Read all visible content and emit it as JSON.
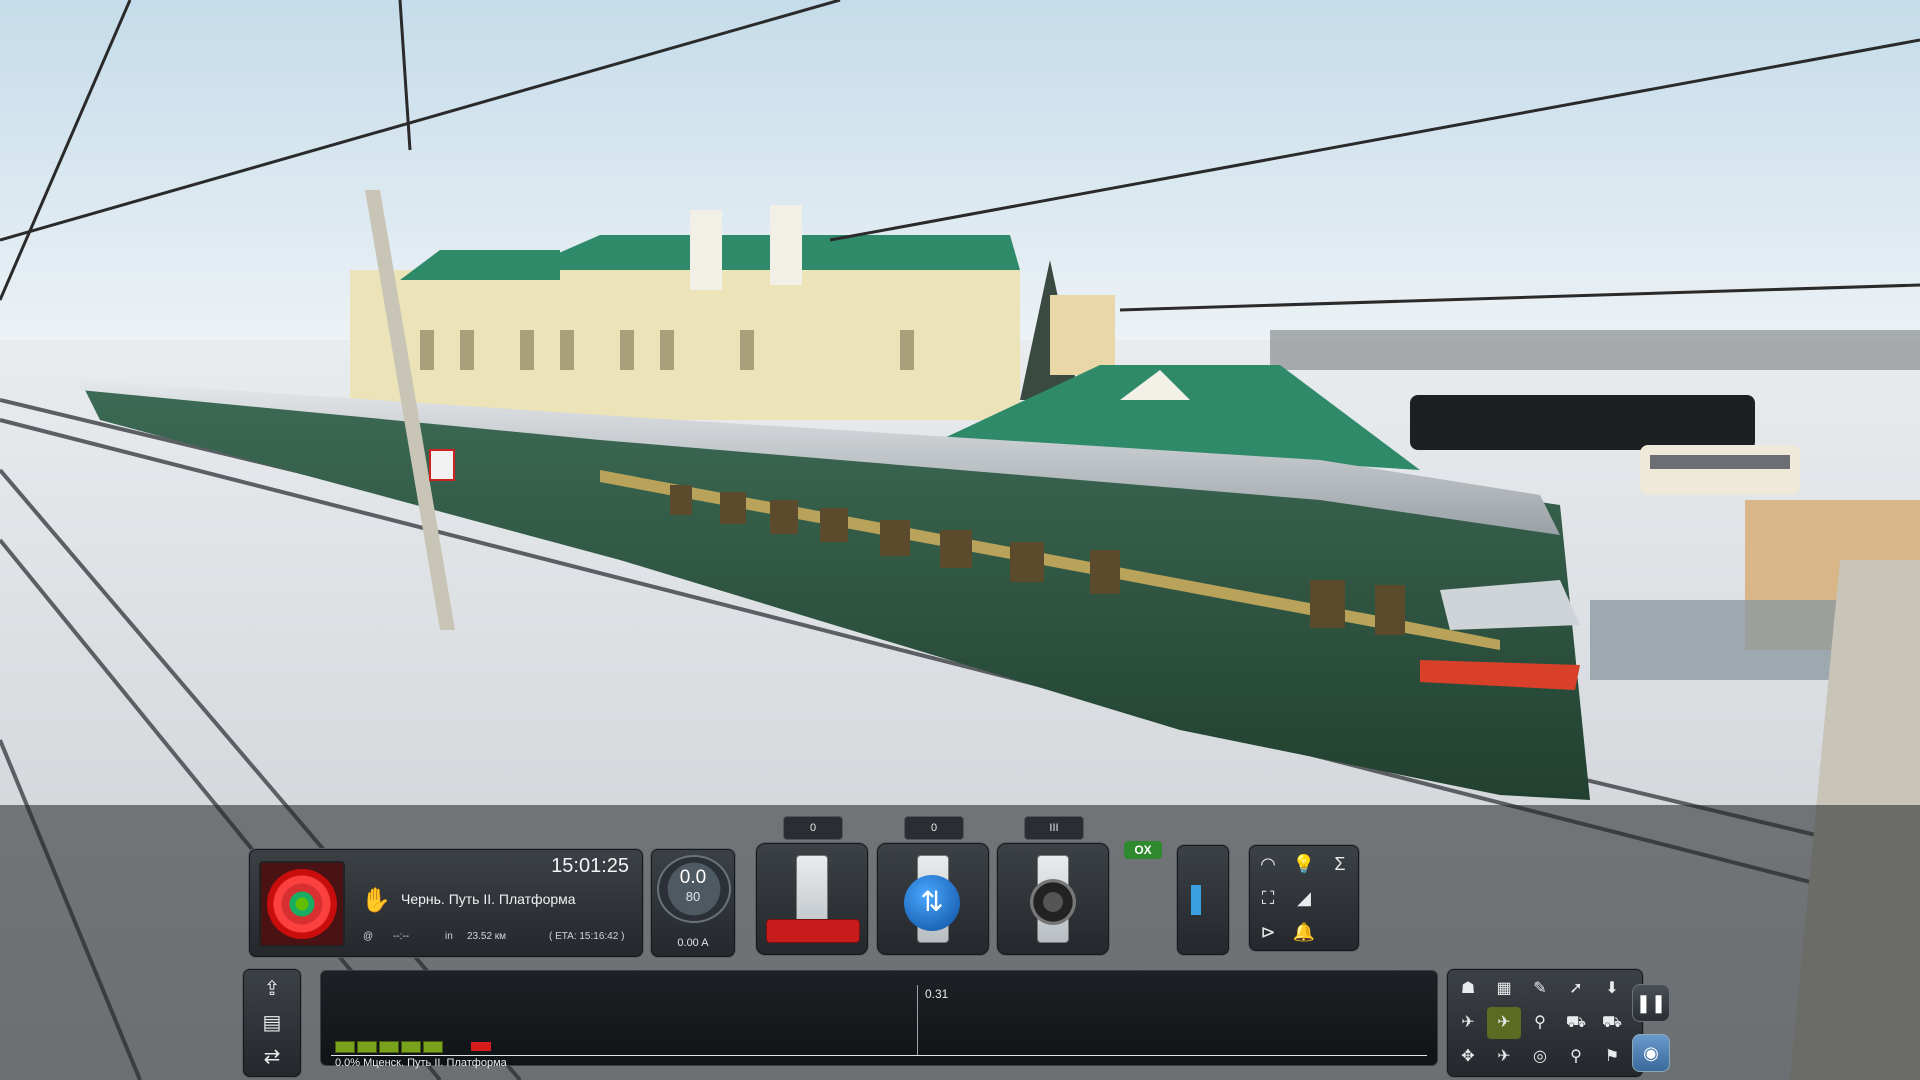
{
  "hud": {
    "clock": "15:01:25",
    "next_stop": "Чернь. Путь II. Платформа",
    "hand_icon": "hand-stop-icon",
    "at_symbol": "@",
    "eta_time": "--:--",
    "in_label": "in",
    "distance": "23.52 км",
    "eta_label": "( ETA: 15:16:42 )",
    "speed": "0.0",
    "speed_limit": "80",
    "amperage": "0.00 A",
    "throttle_notch": "0",
    "reverser_position": "0",
    "brake_position": "III",
    "ox_badge": "OX",
    "track_distance": "0.31",
    "route_progress": "0.0% Мценск. Путь II. Платформа",
    "colors": {
      "accent_green": "#79a31c",
      "signal_red": "#c81c1c",
      "reverser_blue": "#1f77d0"
    }
  },
  "icons": {
    "functions": [
      "wiper-icon",
      "headlight-icon",
      "sum-icon",
      "door-icon",
      "sander-icon",
      "blank",
      "horn-icon",
      "bell-icon",
      "blank"
    ],
    "left_stack": [
      "driver-seat-icon",
      "timetable-icon",
      "coupling-icon"
    ],
    "cameras": [
      "cab-camera-icon",
      "head-out-camera-icon",
      "external-camera-icon",
      "free-camera-icon",
      "down-arrow-icon",
      "passenger-camera-icon",
      "cab2-camera-icon",
      "lineside-camera-icon",
      "car-camera-icon",
      "car2-camera-icon",
      "cycle-camera-icon",
      "aerial-camera-icon",
      "map-camera-icon",
      "search-camera-icon",
      "marker-camera-icon"
    ]
  },
  "controls": {
    "pause": "pause-icon",
    "screenshot": "camera-icon"
  }
}
